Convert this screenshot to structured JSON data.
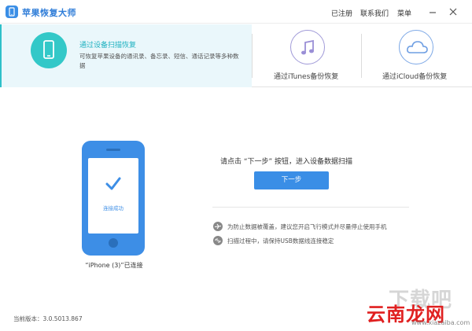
{
  "titlebar": {
    "app_title": "苹果恢复大师",
    "links": [
      "已注册",
      "联系我们",
      "菜单"
    ],
    "icons": [
      "minimize-icon",
      "close-icon"
    ]
  },
  "modes": {
    "device_scan": {
      "title": "通过设备扫描恢复",
      "description": "可恢复苹果设备的通讯录、备忘录、短信、通话记录等多种数据"
    },
    "itunes_label": "通过iTunes备份恢复",
    "icloud_label": "通过iCloud备份恢复"
  },
  "device": {
    "status": "连接成功",
    "label": "“iPhone (3)”已连接"
  },
  "instruction": "请点击 “下一步” 按钮，进入设备数据扫描",
  "next_button": "下一步",
  "tips": [
    "为防止数据被覆盖，建议您开启飞行模式并尽量停止使用手机",
    "扫描过程中，请保持USB数据线连接稳定"
  ],
  "version": "当前版本：3.0.5013.867",
  "watermark": {
    "top": "下载吧",
    "main": "云南龙网",
    "sub": "www.xiazaiba.com"
  },
  "colors": {
    "accent": "#3a8ee6",
    "teal": "#33c8c8",
    "itunes": "#a09ad8",
    "icloud": "#7ea9e6"
  }
}
